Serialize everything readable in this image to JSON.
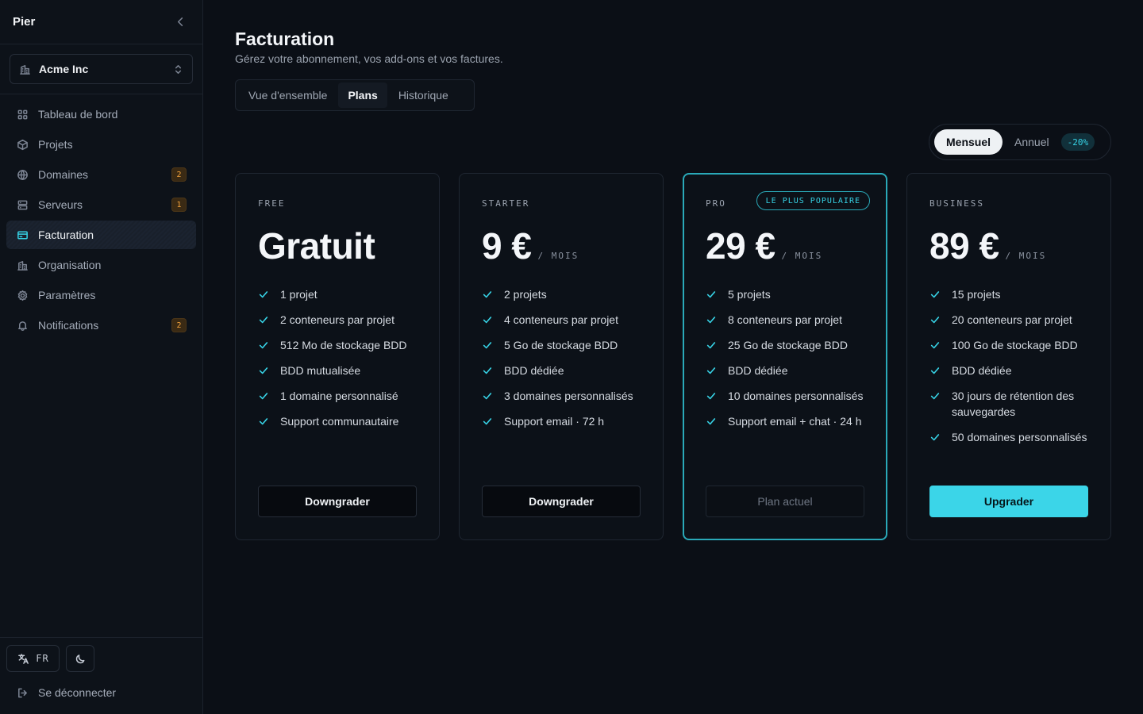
{
  "sidebar": {
    "brand": "Pier",
    "org_name": "Acme Inc",
    "items": [
      {
        "label": "Tableau de bord",
        "icon": "grid-icon",
        "badge": ""
      },
      {
        "label": "Projets",
        "icon": "cube-icon",
        "badge": ""
      },
      {
        "label": "Domaines",
        "icon": "globe-icon",
        "badge": "2"
      },
      {
        "label": "Serveurs",
        "icon": "server-icon",
        "badge": "1"
      },
      {
        "label": "Facturation",
        "icon": "credit-card-icon",
        "badge": "",
        "active": true
      },
      {
        "label": "Organisation",
        "icon": "building-icon",
        "badge": ""
      },
      {
        "label": "Paramètres",
        "icon": "gear-icon",
        "badge": ""
      },
      {
        "label": "Notifications",
        "icon": "bell-icon",
        "badge": "2"
      }
    ],
    "lang_label": "FR",
    "logout_label": "Se déconnecter"
  },
  "header": {
    "title": "Facturation",
    "subtitle": "Gérez votre abonnement, vos add-ons et vos factures."
  },
  "tabs": [
    {
      "label": "Vue d'ensemble"
    },
    {
      "label": "Plans",
      "active": true
    },
    {
      "label": "Historique"
    }
  ],
  "billing_toggle": {
    "monthly": "Mensuel",
    "annual": "Annuel",
    "discount": "-20%",
    "selected": "monthly"
  },
  "plans": [
    {
      "tier": "FREE",
      "price": "Gratuit",
      "period": "",
      "features": [
        "1 projet",
        "2 conteneurs par projet",
        "512 Mo de stockage BDD",
        "BDD mutualisée",
        "1 domaine personnalisé",
        "Support communautaire"
      ],
      "button": "Downgrader",
      "button_style": "default"
    },
    {
      "tier": "STARTER",
      "price": "9 €",
      "period": "/ MOIS",
      "features": [
        "2 projets",
        "4 conteneurs par projet",
        "5 Go de stockage BDD",
        "BDD dédiée",
        "3 domaines personnalisés",
        "Support email · 72 h"
      ],
      "button": "Downgrader",
      "button_style": "default"
    },
    {
      "tier": "PRO",
      "badge": "LE PLUS POPULAIRE",
      "price": "29 €",
      "period": "/ MOIS",
      "features": [
        "5 projets",
        "8 conteneurs par projet",
        "25 Go de stockage BDD",
        "BDD dédiée",
        "10 domaines personnalisés",
        "Support email + chat · 24 h"
      ],
      "button": "Plan actuel",
      "button_style": "current"
    },
    {
      "tier": "BUSINESS",
      "price": "89 €",
      "period": "/ MOIS",
      "features": [
        "15 projets",
        "20 conteneurs par projet",
        "100 Go de stockage BDD",
        "BDD dédiée",
        "30 jours de rétention des sauvegardes",
        "50 domaines personnalisés"
      ],
      "button": "Upgrader",
      "button_style": "upgrade"
    }
  ],
  "colors": {
    "background": "#0b0f16",
    "accent": "#37d3e6",
    "badge": "#f0a13c"
  }
}
